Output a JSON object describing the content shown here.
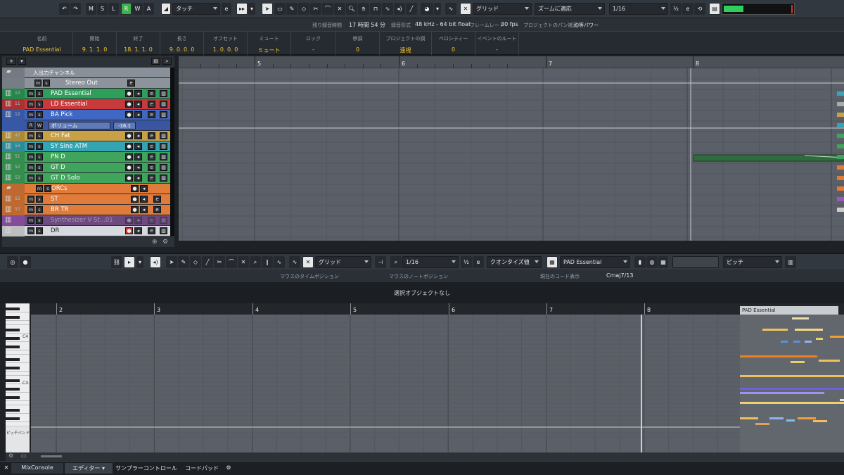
{
  "toolbar": {
    "mode_buttons": [
      "M",
      "S",
      "L",
      "R",
      "W",
      "A"
    ],
    "automation_mode": "タッチ",
    "snap_type": "グリッド",
    "zoom_mode": "ズームに適応",
    "quantize": "1/16"
  },
  "status": {
    "rec_time_label": "残り録音時間",
    "rec_time_value": "17 時間 54 分",
    "rec_format_label": "録音形式",
    "rec_format_value": "48 kHz - 64 bit float",
    "framerate_label": "フレームレート",
    "framerate_value": "30 fps",
    "pan_label": "プロジェクトのパン補正",
    "pan_value": "均等パワー"
  },
  "info_line": [
    {
      "label": "名前",
      "value": "PAD Essential"
    },
    {
      "label": "開始",
      "value": "9. 1. 1.  0"
    },
    {
      "label": "終了",
      "value": "18. 1. 1.  0"
    },
    {
      "label": "長さ",
      "value": "9. 0. 0.  0"
    },
    {
      "label": "オフセット",
      "value": "1. 0. 0.  0"
    },
    {
      "label": "ミュート",
      "value": "ミュート"
    },
    {
      "label": "ロック",
      "value": "-"
    },
    {
      "label": "移調",
      "value": "0"
    },
    {
      "label": "プロジェクトの調",
      "value": "遠視"
    },
    {
      "label": "ベロシティー",
      "value": "0"
    },
    {
      "label": "イベントのルート",
      "value": "-"
    }
  ],
  "tracks": [
    {
      "name": "入出力チャンネル",
      "num": "",
      "color": "#8a9099"
    },
    {
      "name": "Stereo Out",
      "num": "",
      "color": "#8c939b"
    },
    {
      "name": "PAD Essential",
      "num": "10",
      "color": "#2e9e5a"
    },
    {
      "name": "LD Essential",
      "num": "11",
      "color": "#c8393a"
    },
    {
      "name": "BA Pick",
      "num": "12",
      "color": "#4068c2"
    },
    {
      "name": "ボリューム",
      "num": "",
      "color": "#4068c2"
    },
    {
      "name": "CH Fat",
      "num": "47",
      "color": "#c8a046"
    },
    {
      "name": "SY Sine ATM",
      "num": "59",
      "color": "#34a4b2"
    },
    {
      "name": "PN D",
      "num": "51",
      "color": "#3fa55c"
    },
    {
      "name": "GT D",
      "num": "52",
      "color": "#3fa55c"
    },
    {
      "name": "GT D Solo",
      "num": "53",
      "color": "#3fa55c"
    },
    {
      "name": "ORCs",
      "num": "",
      "color": "#e07b39"
    },
    {
      "name": "ST",
      "num": "55",
      "color": "#e07b39"
    },
    {
      "name": "BR TR",
      "num": "57",
      "color": "#e07b39"
    },
    {
      "name": "Synthesizer V St...01",
      "num": "",
      "color": "#9b58b6"
    },
    {
      "name": "DR",
      "num": "58",
      "color": "#d6d9dd"
    }
  ],
  "volume_value": "-16.1",
  "arrange_bars": [
    "5",
    "6",
    "7",
    "8"
  ],
  "editor": {
    "snap_type": "グリッド",
    "quantize": "1/16",
    "quantize_preset": "クオンタイズ値",
    "track": "PAD Essential",
    "controller": "ピッチ",
    "mouse_time_label": "マウスのタイムポジション",
    "mouse_note_label": "マウスのノートポジション",
    "chord_label": "現在のコード表示",
    "chord_value": "Cmaj7/13",
    "no_selection": "選択オブジェクトなし",
    "bars": [
      "2",
      "3",
      "4",
      "5",
      "6",
      "7",
      "8"
    ],
    "part_name": "PAD Essential",
    "key_labels": [
      "C4",
      "C3"
    ],
    "lane_label": "ピッチベンド"
  },
  "bottom_tabs": [
    "MixConsole",
    "エディター",
    "サンプラーコントロール",
    "コードパッド"
  ],
  "colors": {
    "accent": "#f2c230",
    "record_green": "#3db24a",
    "meter": "#2ecf5a"
  }
}
